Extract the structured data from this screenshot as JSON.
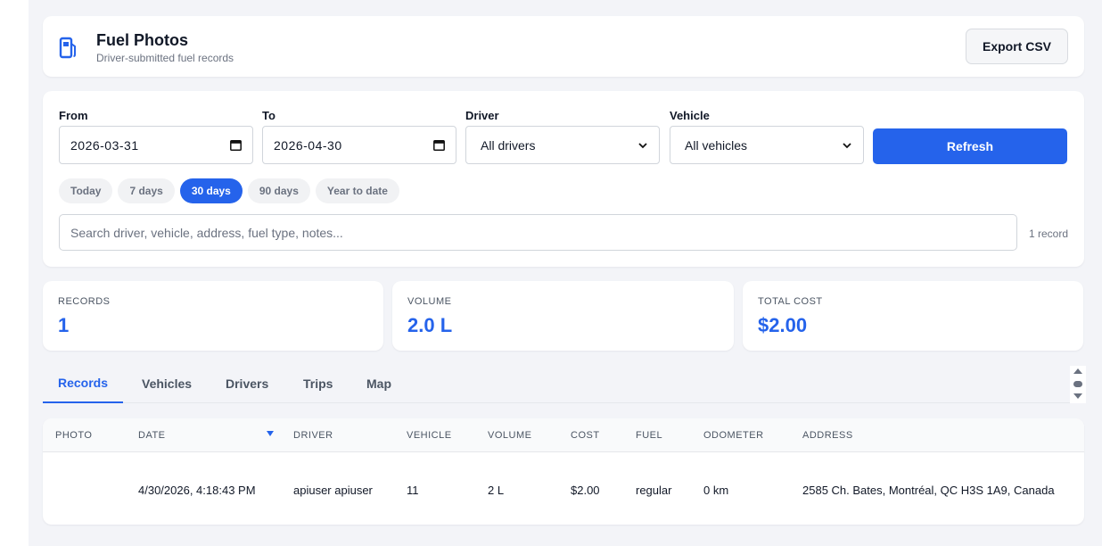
{
  "header": {
    "title": "Fuel Photos",
    "subtitle": "Driver-submitted fuel records",
    "export_label": "Export CSV",
    "icon": "fuel-pump-icon"
  },
  "filters": {
    "from_label": "From",
    "from_value": "2026-03-31",
    "to_label": "To",
    "to_value": "2026-04-30",
    "driver_label": "Driver",
    "driver_value": "All drivers",
    "vehicle_label": "Vehicle",
    "vehicle_value": "All vehicles",
    "refresh_label": "Refresh",
    "ranges": [
      "Today",
      "7 days",
      "30 days",
      "90 days",
      "Year to date"
    ],
    "active_range": "30 days",
    "search_placeholder": "Search driver, vehicle, address, fuel type, notes...",
    "record_count": "1 record"
  },
  "stats": {
    "records_label": "RECORDS",
    "records_value": "1",
    "volume_label": "VOLUME",
    "volume_value": "2.0 L",
    "cost_label": "TOTAL COST",
    "cost_value": "$2.00"
  },
  "tabs": [
    "Records",
    "Vehicles",
    "Drivers",
    "Trips",
    "Map"
  ],
  "active_tab": "Records",
  "table": {
    "columns": [
      "PHOTO",
      "DATE",
      "DRIVER",
      "VEHICLE",
      "VOLUME",
      "COST",
      "FUEL",
      "ODOMETER",
      "ADDRESS"
    ],
    "sorted_column": "DATE",
    "sort_direction": "descending",
    "rows": [
      {
        "photo": "",
        "date": "4/30/2026, 4:18:43 PM",
        "driver": "apiuser apiuser",
        "vehicle": "11",
        "volume": "2 L",
        "cost": "$2.00",
        "fuel": "regular",
        "odometer": "0 km",
        "address": "2585 Ch. Bates, Montréal, QC H3S 1A9, Canada"
      }
    ]
  },
  "colors": {
    "accent": "#2563eb",
    "background": "#f3f4f8",
    "card": "#ffffff",
    "muted_text": "#6b7280"
  }
}
